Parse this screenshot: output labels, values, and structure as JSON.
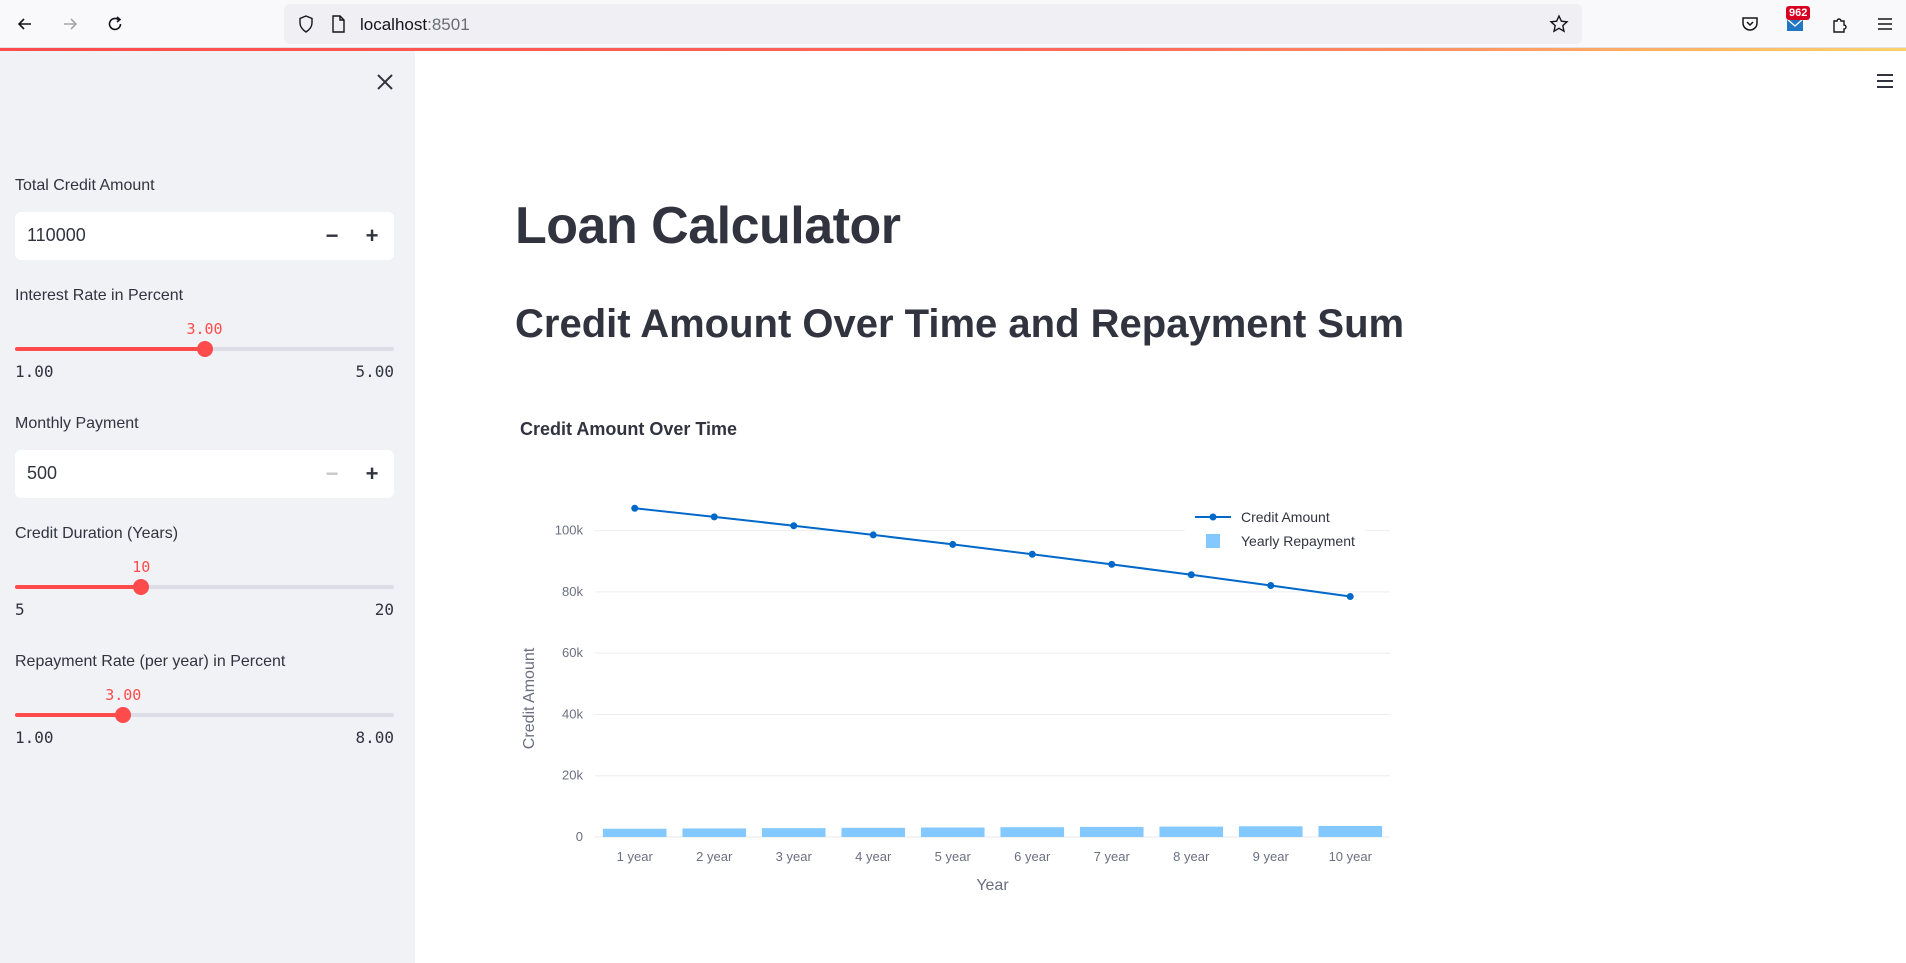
{
  "browser": {
    "url_host": "localhost",
    "url_port": ":8501",
    "mail_badge": "962"
  },
  "sidebar": {
    "credit_amount": {
      "label": "Total Credit Amount",
      "value": "110000",
      "minus": "−",
      "plus": "+"
    },
    "interest_rate": {
      "label": "Interest Rate in Percent",
      "value": "3.00",
      "min": "1.00",
      "max": "5.00",
      "fraction": 0.5
    },
    "monthly_payment": {
      "label": "Monthly Payment",
      "value": "500",
      "minus": "−",
      "plus": "+"
    },
    "credit_duration": {
      "label": "Credit Duration (Years)",
      "value": "10",
      "min": "5",
      "max": "20",
      "fraction": 0.3333
    },
    "repayment_rate": {
      "label": "Repayment Rate (per year) in Percent",
      "value": "3.00",
      "min": "1.00",
      "max": "8.00",
      "fraction": 0.2857
    }
  },
  "main": {
    "title": "Loan Calculator",
    "subtitle": "Credit Amount Over Time and Repayment Sum"
  },
  "chart_data": {
    "type": "line",
    "title": "Credit Amount Over Time",
    "xlabel": "Year",
    "ylabel": "Credit Amount",
    "categories": [
      "1 year",
      "2 year",
      "3 year",
      "4 year",
      "5 year",
      "6 year",
      "7 year",
      "8 year",
      "9 year",
      "10 year"
    ],
    "yticks": [
      "0",
      "20k",
      "40k",
      "60k",
      "80k",
      "100k"
    ],
    "ylim": [
      0,
      110000
    ],
    "legend_position": "top-right",
    "series": [
      {
        "name": "Credit Amount",
        "kind": "line",
        "color": "#0068c9",
        "values": [
          107300,
          104500,
          101600,
          98600,
          95500,
          92300,
          89000,
          85600,
          82100,
          78500
        ]
      },
      {
        "name": "Yearly Repayment",
        "kind": "bar",
        "color": "#83c9ff",
        "values": [
          2700,
          2800,
          2900,
          3000,
          3100,
          3200,
          3300,
          3400,
          3500,
          3600
        ]
      }
    ]
  }
}
